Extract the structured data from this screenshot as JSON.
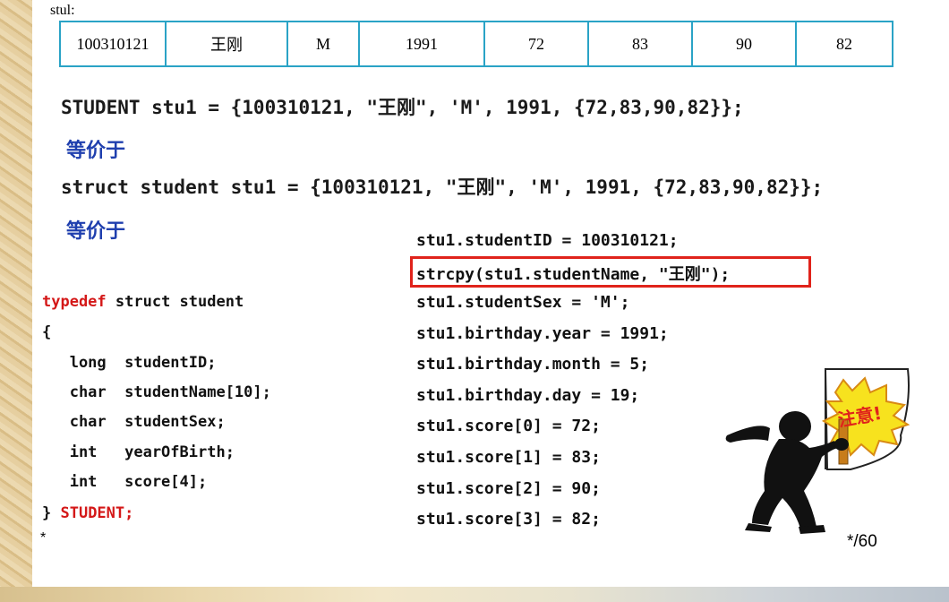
{
  "table": {
    "label": "stul:",
    "cells": [
      "100310121",
      "王刚",
      "M",
      "1991",
      "72",
      "83",
      "90",
      "82"
    ]
  },
  "lines": {
    "student_init": "STUDENT stu1 = {100310121, \"王刚\", 'M', 1991, {72,83,90,82}};",
    "equiv1": "等价于",
    "struct_init": "struct student stu1 = {100310121, \"王刚\", 'M', 1991, {72,83,90,82}};",
    "equiv2": "等价于"
  },
  "typedef_code": {
    "kw_typedef": "typedef",
    "head_rest": " struct student",
    "open_brace": "{",
    "fields": [
      "   long  studentID;",
      "   char  studentName[10];",
      "   char  studentSex;",
      "   int   yearOfBirth;",
      "   int   score[4];"
    ],
    "close_brace": "} ",
    "type_name": "STUDENT;"
  },
  "assign_code": [
    "stu1.studentID = 100310121;",
    "strcpy(stu1.studentName, \"王刚\");",
    "stu1.studentSex = 'M';",
    "stu1.birthday.year = 1991;",
    "stu1.birthday.month = 5;",
    "stu1.birthday.day = 19;",
    "stu1.score[0] = 72;",
    "stu1.score[1] = 83;",
    "stu1.score[2] = 90;",
    "stu1.score[3] = 82;"
  ],
  "clipart_sign": "注意!",
  "footer": {
    "left": "*",
    "right": "*/60"
  }
}
